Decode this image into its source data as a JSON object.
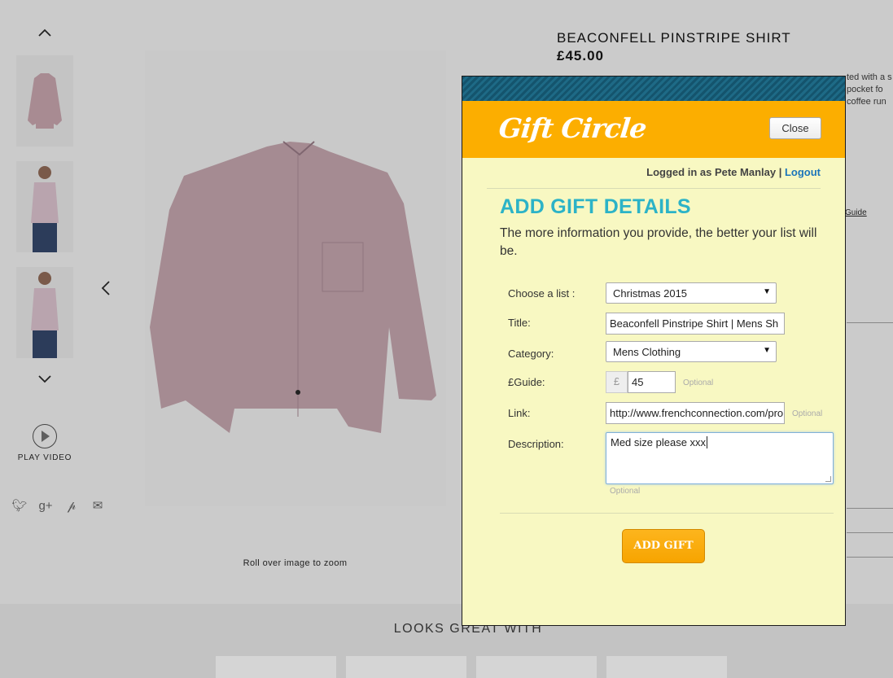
{
  "product": {
    "title": "BEACONFELL PINSTRIPE SHIRT",
    "price": "£45.00",
    "zoom_hint": "Roll over image to zoom",
    "play_video": "PLAY VIDEO",
    "description_fragment": "ted with a s\npocket fo\ncoffee run",
    "guide_fragment": "Guide",
    "looks_great_with": "LOOKS GREAT WITH"
  },
  "modal": {
    "logo_text": "Gift Circle",
    "close_label": "Close",
    "logged_in_prefix": "Logged in as Pete Manlay | ",
    "logout_label": "Logout",
    "heading": "ADD GIFT DETAILS",
    "subheading": "The more information you provide, the better your list will be.",
    "fields": {
      "list_label": "Choose a list :",
      "list_value": "Christmas 2015",
      "title_label": "Title:",
      "title_value": "Beaconfell Pinstripe Shirt | Mens Sh",
      "category_label": "Category:",
      "category_value": "Mens Clothing",
      "guide_label": "£Guide:",
      "currency_symbol": "£",
      "guide_value": "45",
      "link_label": "Link:",
      "link_value": "http://www.frenchconnection.com/pro",
      "description_label": "Description:",
      "description_value": "Med size please xxx",
      "optional_label": "Optional"
    },
    "add_button_label": "ADD GIFT"
  },
  "colors": {
    "header_orange": "#fcae00",
    "heading_teal": "#2cb3c7",
    "modal_bg": "#f8f8c2",
    "link_blue": "#1b75bb"
  }
}
